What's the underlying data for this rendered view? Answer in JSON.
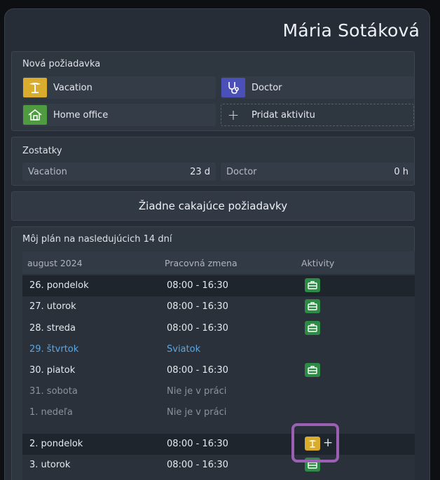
{
  "user": {
    "name": "Mária Sotáková"
  },
  "new_request": {
    "title": "Nová požiadavka",
    "buttons": [
      {
        "label": "Vacation",
        "icon": "palm-tree-icon",
        "color": "#d9ac2e"
      },
      {
        "label": "Doctor",
        "icon": "stethoscope-icon",
        "color": "#4b4fb8"
      },
      {
        "label": "Home office",
        "icon": "house-icon",
        "color": "#4f9b3f"
      },
      {
        "label": "Pridat aktivitu",
        "icon": "plus-icon"
      }
    ]
  },
  "balances": {
    "title": "Zostatky",
    "items": [
      {
        "name": "Vacation",
        "value": "23 d"
      },
      {
        "name": "Doctor",
        "value": "0 h"
      }
    ]
  },
  "pending": {
    "label": "Žiadne cakajúce požiadavky"
  },
  "schedule": {
    "title": "Môj plán na nasledujúcich 14 dní",
    "headers": {
      "month": "august 2024",
      "shift": "Pracovná zmena",
      "activities": "Aktivity"
    },
    "rows": [
      {
        "day": "26. pondelok",
        "shift": "08:00 - 16:30",
        "activity": "briefcase"
      },
      {
        "day": "27. utorok",
        "shift": "08:00 - 16:30",
        "activity": "briefcase"
      },
      {
        "day": "28. streda",
        "shift": "08:00 - 16:30",
        "activity": "briefcase"
      },
      {
        "day": "29. štvrtok",
        "shift": "Sviatok",
        "activity": ""
      },
      {
        "day": "30. piatok",
        "shift": "08:00 - 16:30",
        "activity": "briefcase"
      },
      {
        "day": "31. sobota",
        "shift": "Nie je v práci",
        "activity": ""
      },
      {
        "day": "1. nedeľa",
        "shift": "Nie je v práci",
        "activity": ""
      },
      {
        "day": "2. pondelok",
        "shift": "08:00 - 16:30",
        "activity": "vacation"
      },
      {
        "day": "3. utorok",
        "shift": "08:00 - 16:30",
        "activity": "briefcase"
      }
    ]
  },
  "colors": {
    "accent_work": "#2e8b46",
    "holiday_text": "#5ba7e6",
    "highlight": "#9b5fb3"
  }
}
